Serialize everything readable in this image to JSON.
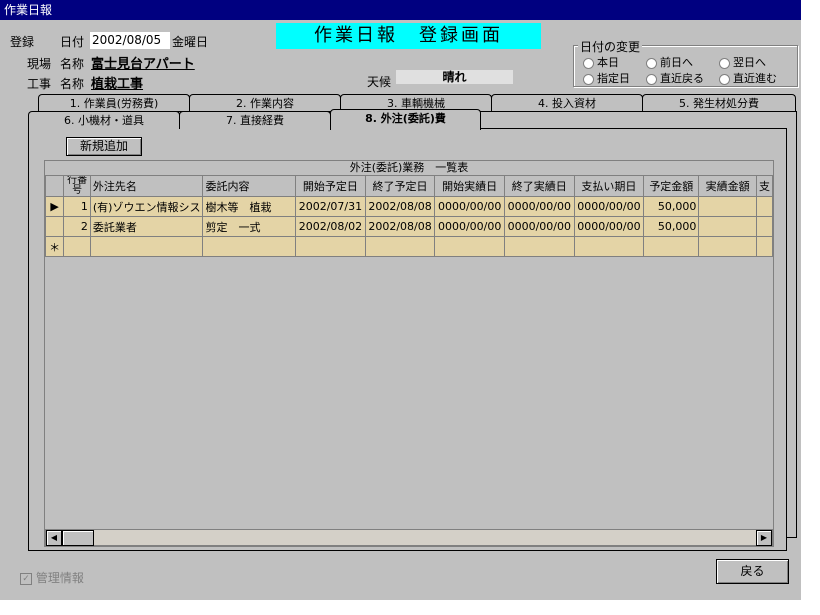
{
  "window": {
    "title": "作業日報"
  },
  "header": {
    "registration_label": "登録",
    "date_label": "日付",
    "date_value": "2002/08/05",
    "weekday": "金曜日",
    "site_label": "現場",
    "site_name_label": "名称",
    "site_name": "富士見台アパート",
    "work_label": "工事",
    "work_name_label": "名称",
    "work_name": "植栽工事",
    "banner": "作業日報　登録画面",
    "weather_label": "天候",
    "weather_value": "晴れ"
  },
  "date_change": {
    "title": "日付の変更",
    "options": [
      "本日",
      "前日へ",
      "翌日へ",
      "指定日",
      "直近戻る",
      "直近進む"
    ]
  },
  "tabs": {
    "row_back": [
      "1. 作業員(労務費)",
      "2. 作業内容",
      "3. 車輌機械",
      "4. 投入資材",
      "5. 発生材処分費"
    ],
    "row_front": [
      "6. 小機材・道具",
      "7. 直接経費",
      "8. 外注(委託)費"
    ],
    "selected": "8. 外注(委託)費"
  },
  "toolbar": {
    "new_button": "新規追加"
  },
  "grid": {
    "caption": "外注(委託)業務　一覧表",
    "columns": [
      "行番号",
      "外注先名",
      "委託内容",
      "開始予定日",
      "終了予定日",
      "開始実績日",
      "終了実績日",
      "支払い期日",
      "予定金額",
      "実績金額",
      "支"
    ],
    "rows": [
      {
        "no": "1",
        "vendor": "(有)ゾウエン情報シス",
        "content": "樹木等　植栽",
        "start_plan": "2002/07/31",
        "end_plan": "2002/08/08",
        "start_actual": "0000/00/00",
        "end_actual": "0000/00/00",
        "pay_due": "0000/00/00",
        "amount_plan": "50,000",
        "amount_actual": ""
      },
      {
        "no": "2",
        "vendor": "委託業者",
        "content": "剪定　一式",
        "start_plan": "2002/08/02",
        "end_plan": "2002/08/08",
        "start_actual": "0000/00/00",
        "end_actual": "0000/00/00",
        "pay_due": "0000/00/00",
        "amount_plan": "50,000",
        "amount_actual": ""
      }
    ],
    "current_marker": "▶",
    "new_marker": "＊"
  },
  "footer": {
    "admin_checkbox": "管理情報",
    "back_button": "戻る"
  }
}
